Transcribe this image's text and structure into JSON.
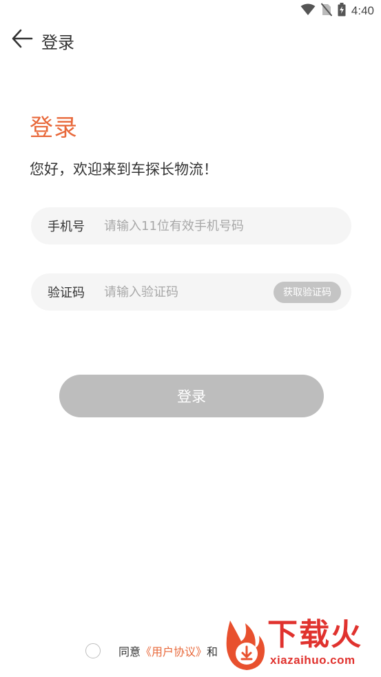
{
  "status_bar": {
    "time": "4:40",
    "icons": [
      "wifi-icon",
      "no-sim-icon",
      "battery-charging-icon"
    ]
  },
  "app_bar": {
    "back_icon": "arrow-left-icon",
    "title": "登录"
  },
  "heading": "登录",
  "welcome": "您好，欢迎来到车探长物流！",
  "phone_field": {
    "label": "手机号",
    "value": "",
    "placeholder": "请输入11位有效手机号码"
  },
  "code_field": {
    "label": "验证码",
    "value": "",
    "placeholder": "请输入验证码",
    "button_label": "获取验证码"
  },
  "login_button": "登录",
  "agreement": {
    "prefix": "同意",
    "link_label": "《用户协议》",
    "suffix": "和"
  },
  "watermark": {
    "brand": "下载火",
    "url": "xiazaihuo.com"
  },
  "colors": {
    "accent": "#e8683a",
    "disabled_button": "#bdbdbd",
    "field_bg": "#f5f5f5",
    "watermark": "#e0322e"
  }
}
